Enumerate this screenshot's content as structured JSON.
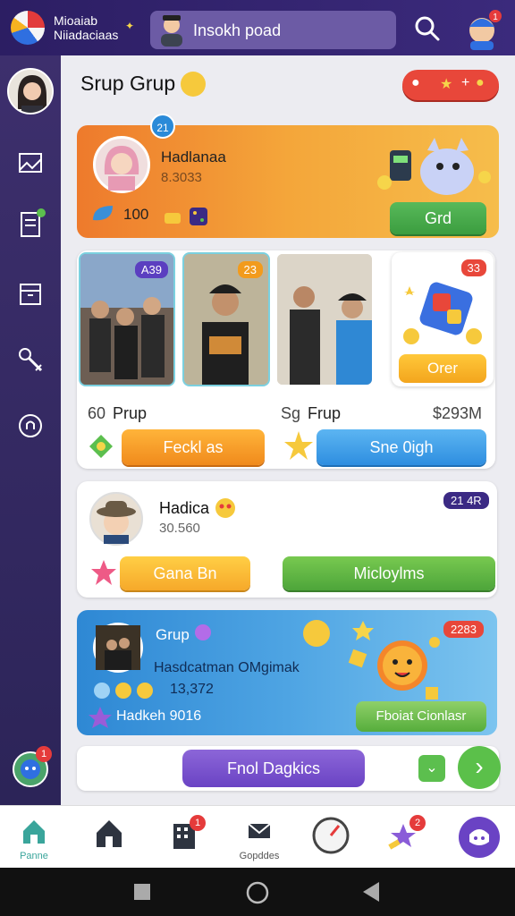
{
  "app": {
    "title": "Mioaiab Niiadaciaas"
  },
  "search": {
    "text": "Insokh poad"
  },
  "section": {
    "title": "Srup Grup"
  },
  "featured": {
    "badge": "21",
    "name": "Hadlanaa",
    "subtitle": "8.3033",
    "stat": "100",
    "cta": "Grd"
  },
  "group_card": {
    "photos": [
      {
        "tag": "A39",
        "tag_color": "#5b3fc0"
      },
      {
        "tag": "23",
        "tag_color": "#f29b1d"
      },
      {
        "tag": ""
      }
    ],
    "offer": {
      "tag": "33",
      "button": "Orer"
    },
    "left_count": "60",
    "left_label": "Prup",
    "mid_prefix": "Sg",
    "mid_label": "Frup",
    "amount": "$293M",
    "button_orange": "Feckl as",
    "button_blue": "Sne 0igh"
  },
  "profile_card": {
    "name": "Hadica",
    "subtitle": "30.560",
    "badge": "21 4R",
    "button_yellow": "Gana Bn",
    "button_green": "Micloylms"
  },
  "promo_card": {
    "title": "Grup",
    "line": "Hasdcatman OMgimak",
    "stat": "13,372",
    "footer": "Hadkeh 9016",
    "badge": "2283",
    "cta": "Fboiat Cionlasr"
  },
  "action_row": {
    "button": "Fnol Dagkics"
  },
  "tabs": [
    {
      "label": "Panne",
      "badge": ""
    },
    {
      "label": "",
      "badge": ""
    },
    {
      "label": "",
      "badge": "1"
    },
    {
      "label": "Gopddes",
      "badge": ""
    },
    {
      "label": "",
      "badge": ""
    },
    {
      "label": "",
      "badge": "2"
    },
    {
      "label": "",
      "badge": ""
    }
  ],
  "profile_badge": "1",
  "colors": {
    "brand": "#3b2a7c",
    "accent_green": "#4fae3e",
    "accent_orange": "#f39a24",
    "accent_blue": "#3aa2e8",
    "accent_purple": "#6a43c4"
  }
}
